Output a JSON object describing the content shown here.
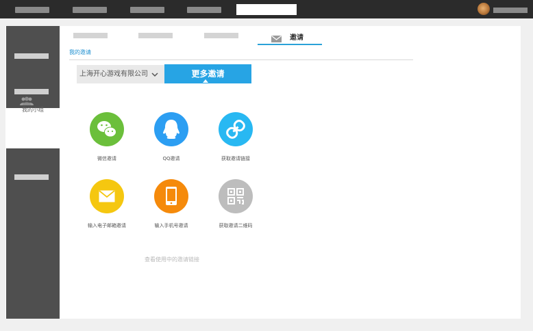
{
  "topbar": {
    "active_tab_label": "",
    "user_name": ""
  },
  "sidebar": {
    "active_item_label": "我的小组",
    "active_item_icon": "group-icon"
  },
  "tabs": {
    "active_label": "邀请",
    "active_icon": "envelope-icon"
  },
  "main": {
    "section_title": "我的邀请",
    "company_select_value": "上海开心游戏有限公司",
    "more_invites_label": "更多邀请",
    "view_links_text": "查看使用中的邀请链接",
    "invite_options": [
      {
        "label": "微信邀请",
        "icon": "wechat-icon",
        "color": "#6bbf3b"
      },
      {
        "label": "QQ邀请",
        "icon": "qq-icon",
        "color": "#2c9ef2"
      },
      {
        "label": "获取邀请链接",
        "icon": "link-icon",
        "color": "#28b8f2"
      },
      {
        "label": "输入电子邮箱邀请",
        "icon": "mail-icon",
        "color": "#f5c710"
      },
      {
        "label": "输入手机号邀请",
        "icon": "phone-icon",
        "color": "#f58a0b"
      },
      {
        "label": "获取邀请二维码",
        "icon": "qrcode-icon",
        "color": "#bdbdbd"
      }
    ]
  },
  "colors": {
    "accent": "#27a4e4",
    "sidebar_bg": "#4f4f4f",
    "topbar_bg": "#2b2b2b"
  }
}
